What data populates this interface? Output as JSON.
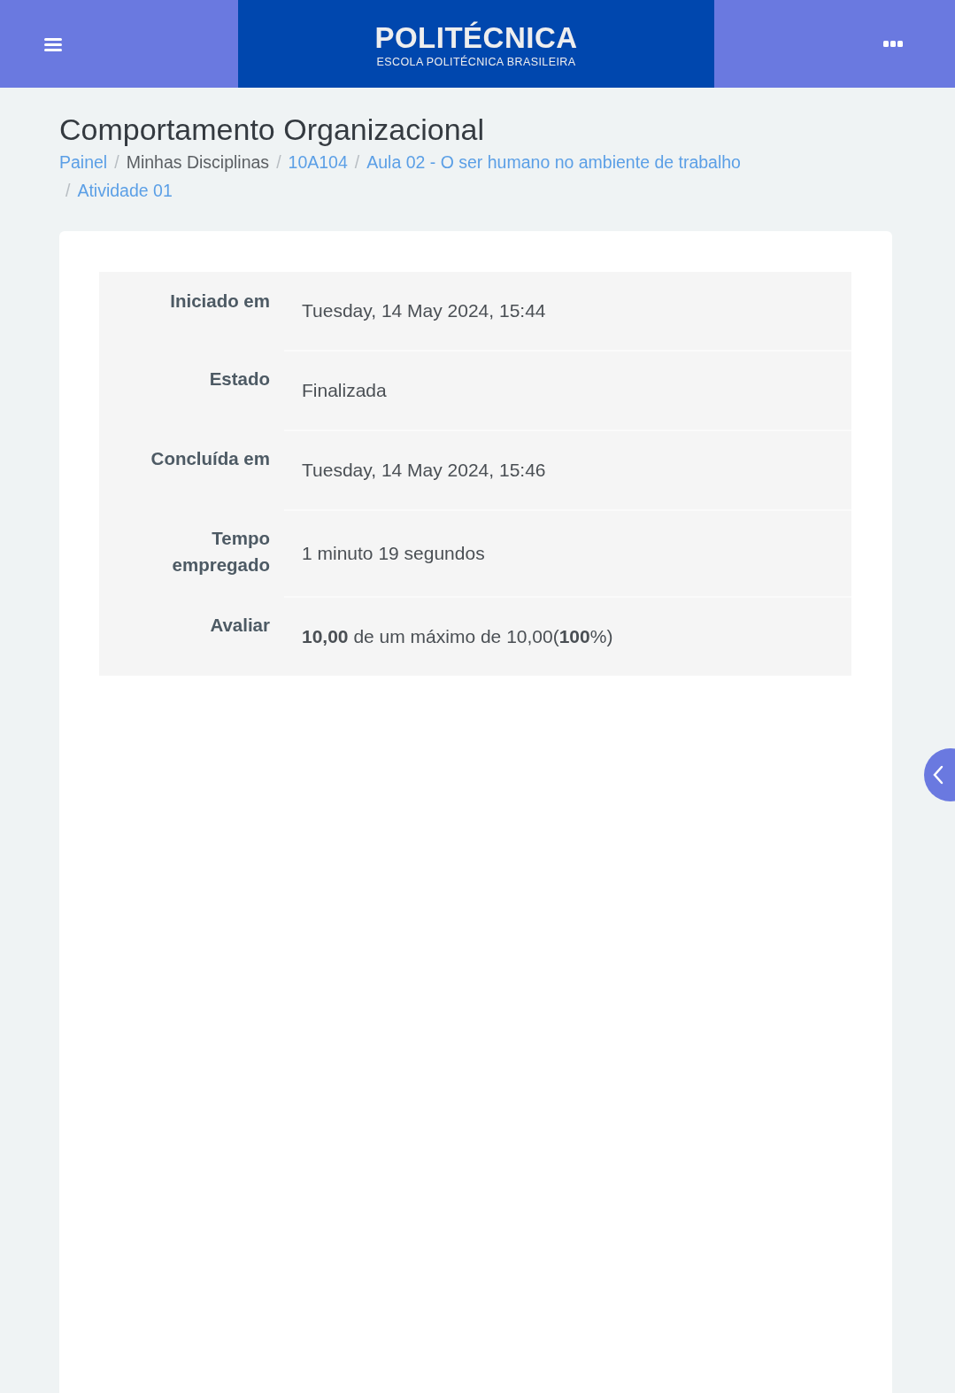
{
  "header": {
    "logo": {
      "title": "POLITÉCNICA",
      "subtitle": "ESCOLA POLITÉCNICA BRASILEIRA"
    }
  },
  "page_title": "Comportamento Organizacional",
  "breadcrumb": {
    "separator": "/",
    "items": [
      {
        "label": "Painel",
        "kind": "link"
      },
      {
        "label": "Minhas Disciplinas",
        "kind": "text"
      },
      {
        "label": "10A104",
        "kind": "link"
      },
      {
        "label": "Aula 02 - O ser humano no ambiente de trabalho",
        "kind": "link"
      },
      {
        "label": "Atividade 01",
        "kind": "link"
      }
    ]
  },
  "summary": [
    {
      "label": "Iniciado em",
      "value": "Tuesday, 14 May 2024, 15:44"
    },
    {
      "label": "Estado",
      "value": "Finalizada"
    },
    {
      "label": "Concluída em",
      "value": "Tuesday, 14 May 2024, 15:46"
    },
    {
      "label": "Tempo empregado",
      "value": "1 minuto 19 segundos"
    },
    {
      "label": "Avaliar",
      "value": "**10,00** de um máximo de 10,00(**100**%)"
    }
  ]
}
